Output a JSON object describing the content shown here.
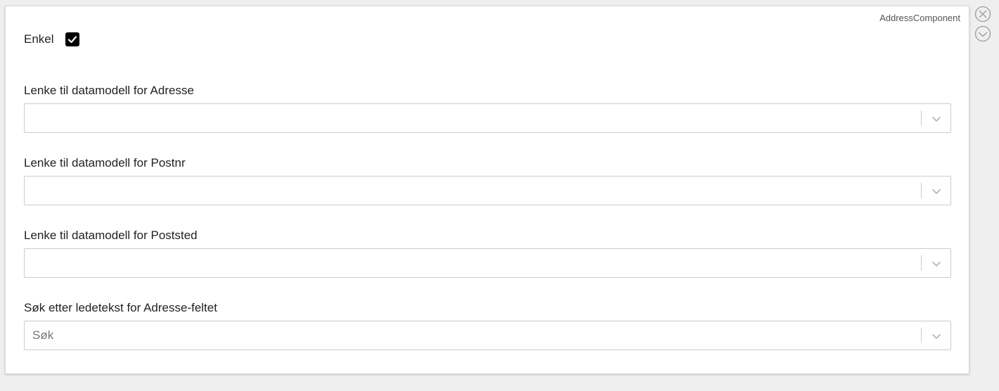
{
  "component_type": "AddressComponent",
  "simple": {
    "label": "Enkel",
    "checked": true
  },
  "fields": [
    {
      "label": "Lenke til datamodell for Adresse",
      "value": ""
    },
    {
      "label": "Lenke til datamodell for Postnr",
      "value": ""
    },
    {
      "label": "Lenke til datamodell for Poststed",
      "value": ""
    },
    {
      "label": "Søk etter ledetekst for Adresse-feltet",
      "value": "Søk"
    }
  ],
  "icons": {
    "close": "close-circle-icon",
    "confirm": "check-circle-icon",
    "dropdown": "chevron-down-icon",
    "checkmark": "checkmark-icon"
  },
  "colors": {
    "background": "#efefef",
    "panel": "#ffffff",
    "border": "#cccccc",
    "checkbox": "#000000",
    "icon_gray": "#9a9a9a"
  }
}
